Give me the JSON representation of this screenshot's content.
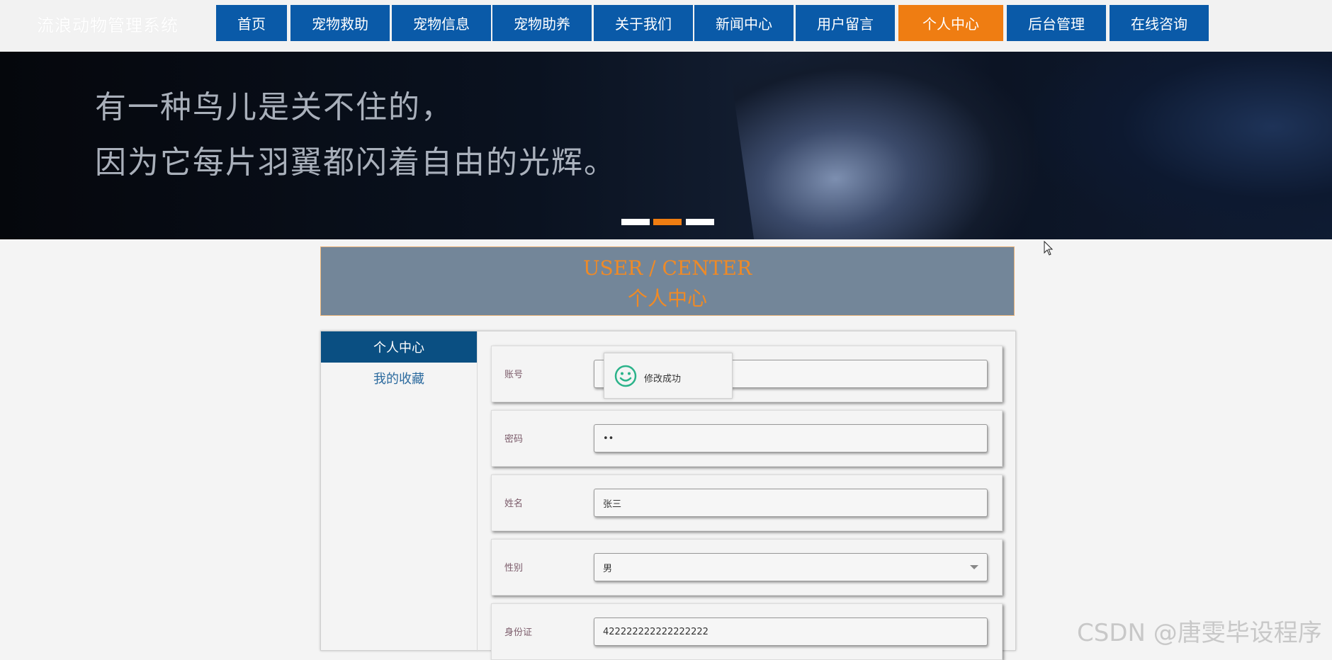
{
  "site": {
    "title": "流浪动物管理系统"
  },
  "nav": {
    "items": [
      {
        "label": "首页"
      },
      {
        "label": "宠物救助"
      },
      {
        "label": "宠物信息"
      },
      {
        "label": "宠物助养"
      },
      {
        "label": "关于我们"
      },
      {
        "label": "新闻中心"
      },
      {
        "label": "用户留言"
      },
      {
        "label": "个人中心",
        "active": true
      },
      {
        "label": "后台管理"
      },
      {
        "label": "在线咨询"
      }
    ]
  },
  "banner": {
    "line1": "有一种鸟儿是关不住的，",
    "line2": "因为它每片羽翼都闪着自由的光辉。",
    "active_dot": 2
  },
  "section": {
    "title_en": "USER / CENTER",
    "title_cn": "个人中心"
  },
  "sidebar": {
    "items": [
      {
        "label": "个人中心",
        "active": true
      },
      {
        "label": "我的收藏"
      }
    ]
  },
  "form": {
    "fields": [
      {
        "label": "账号",
        "value": ""
      },
      {
        "label": "密码",
        "value": "••"
      },
      {
        "label": "姓名",
        "value": "张三"
      },
      {
        "label": "性别",
        "value": "男",
        "type": "select"
      },
      {
        "label": "身份证",
        "value": "422222222222222222"
      }
    ]
  },
  "toast": {
    "message": "修改成功",
    "icon": "smile-icon"
  },
  "watermark": "CSDN @唐雯毕设程序",
  "colors": {
    "nav": "#0a5aa8",
    "accent": "#ef7d12",
    "sidebar_active": "#0a4f82",
    "toast_icon": "#2bb38a"
  }
}
